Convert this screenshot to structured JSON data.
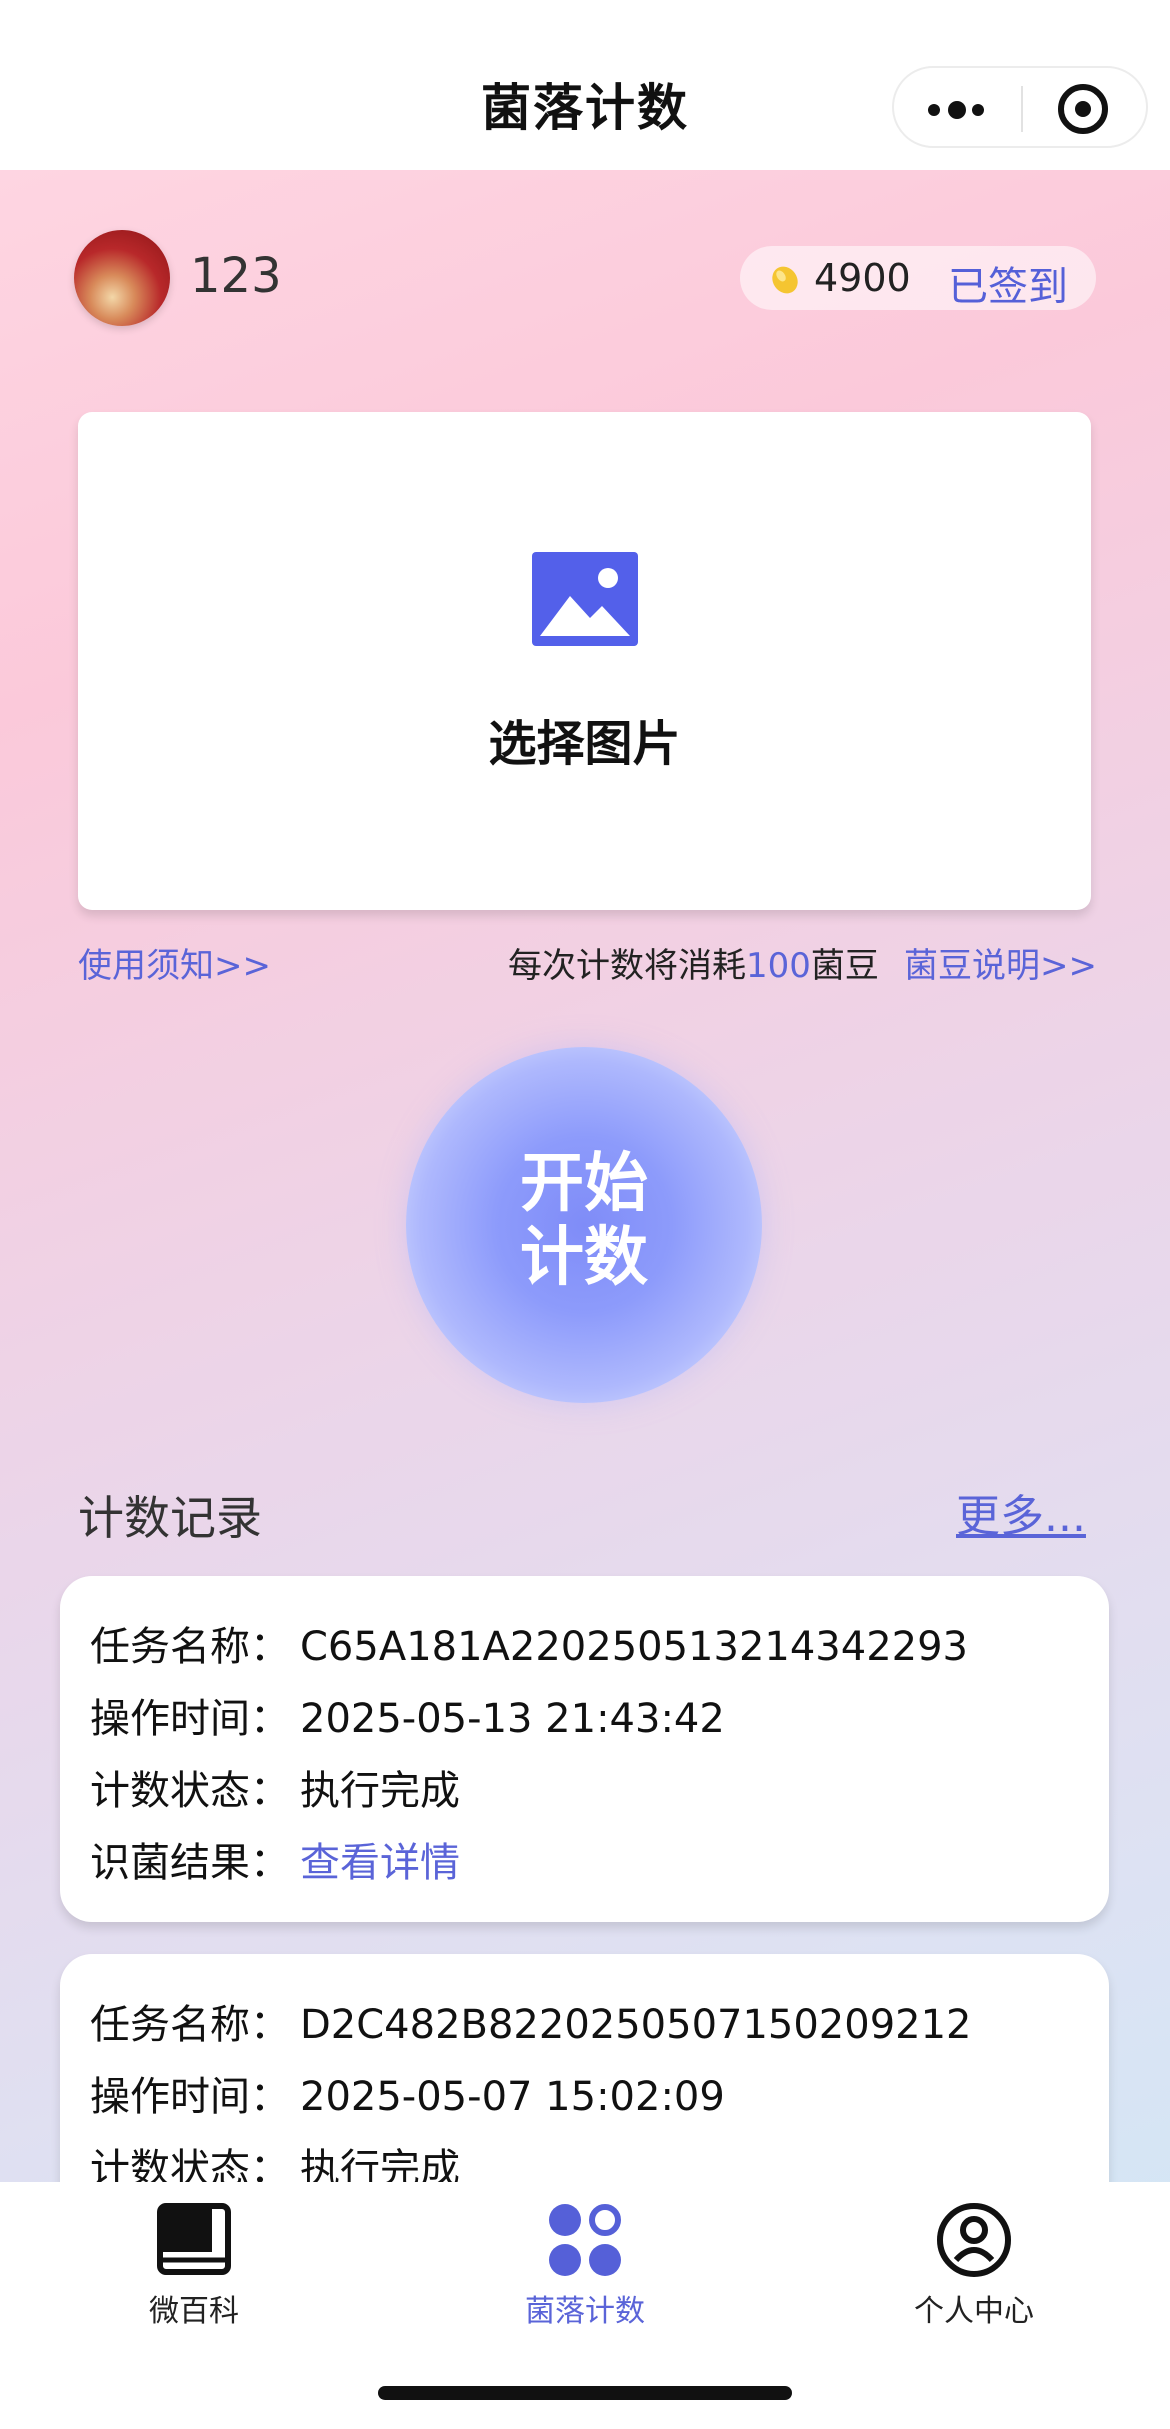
{
  "navbar": {
    "title": "菌落计数",
    "more_icon": "more-dots-icon",
    "close_icon": "target-icon"
  },
  "user": {
    "name": "123",
    "coins": "4900",
    "sign_status": "已签到"
  },
  "upload": {
    "label": "选择图片",
    "icon": "image-icon"
  },
  "info": {
    "usage_link": "使用须知>>",
    "consume_prefix": "每次计数将消耗",
    "consume_amount": "100",
    "consume_suffix": "菌豆",
    "bean_link": "菌豆说明>>"
  },
  "start_button": {
    "line1": "开始",
    "line2": "计数"
  },
  "records": {
    "title": "计数记录",
    "more": "更多...",
    "items": [
      {
        "task_label": "任务名称：",
        "task": "C65A181A220250513214342293",
        "time_label": "操作时间：",
        "time": "2025-05-13 21:43:42",
        "status_label": "计数状态：",
        "status": "执行完成",
        "result_label": "识菌结果：",
        "result": "查看详情"
      },
      {
        "task_label": "任务名称：",
        "task": "D2C482B8220250507150209212",
        "time_label": "操作时间：",
        "time": "2025-05-07 15:02:09",
        "status_label": "计数状态：",
        "status": "执行完成"
      }
    ]
  },
  "tabbar": {
    "tabs": [
      {
        "label": "微百科",
        "icon": "book-icon"
      },
      {
        "label": "菌落计数",
        "icon": "colony-icon"
      },
      {
        "label": "个人中心",
        "icon": "user-icon"
      }
    ],
    "active": 1
  },
  "colors": {
    "accent": "#5a64d8",
    "start_button": "#8d9bfb"
  }
}
